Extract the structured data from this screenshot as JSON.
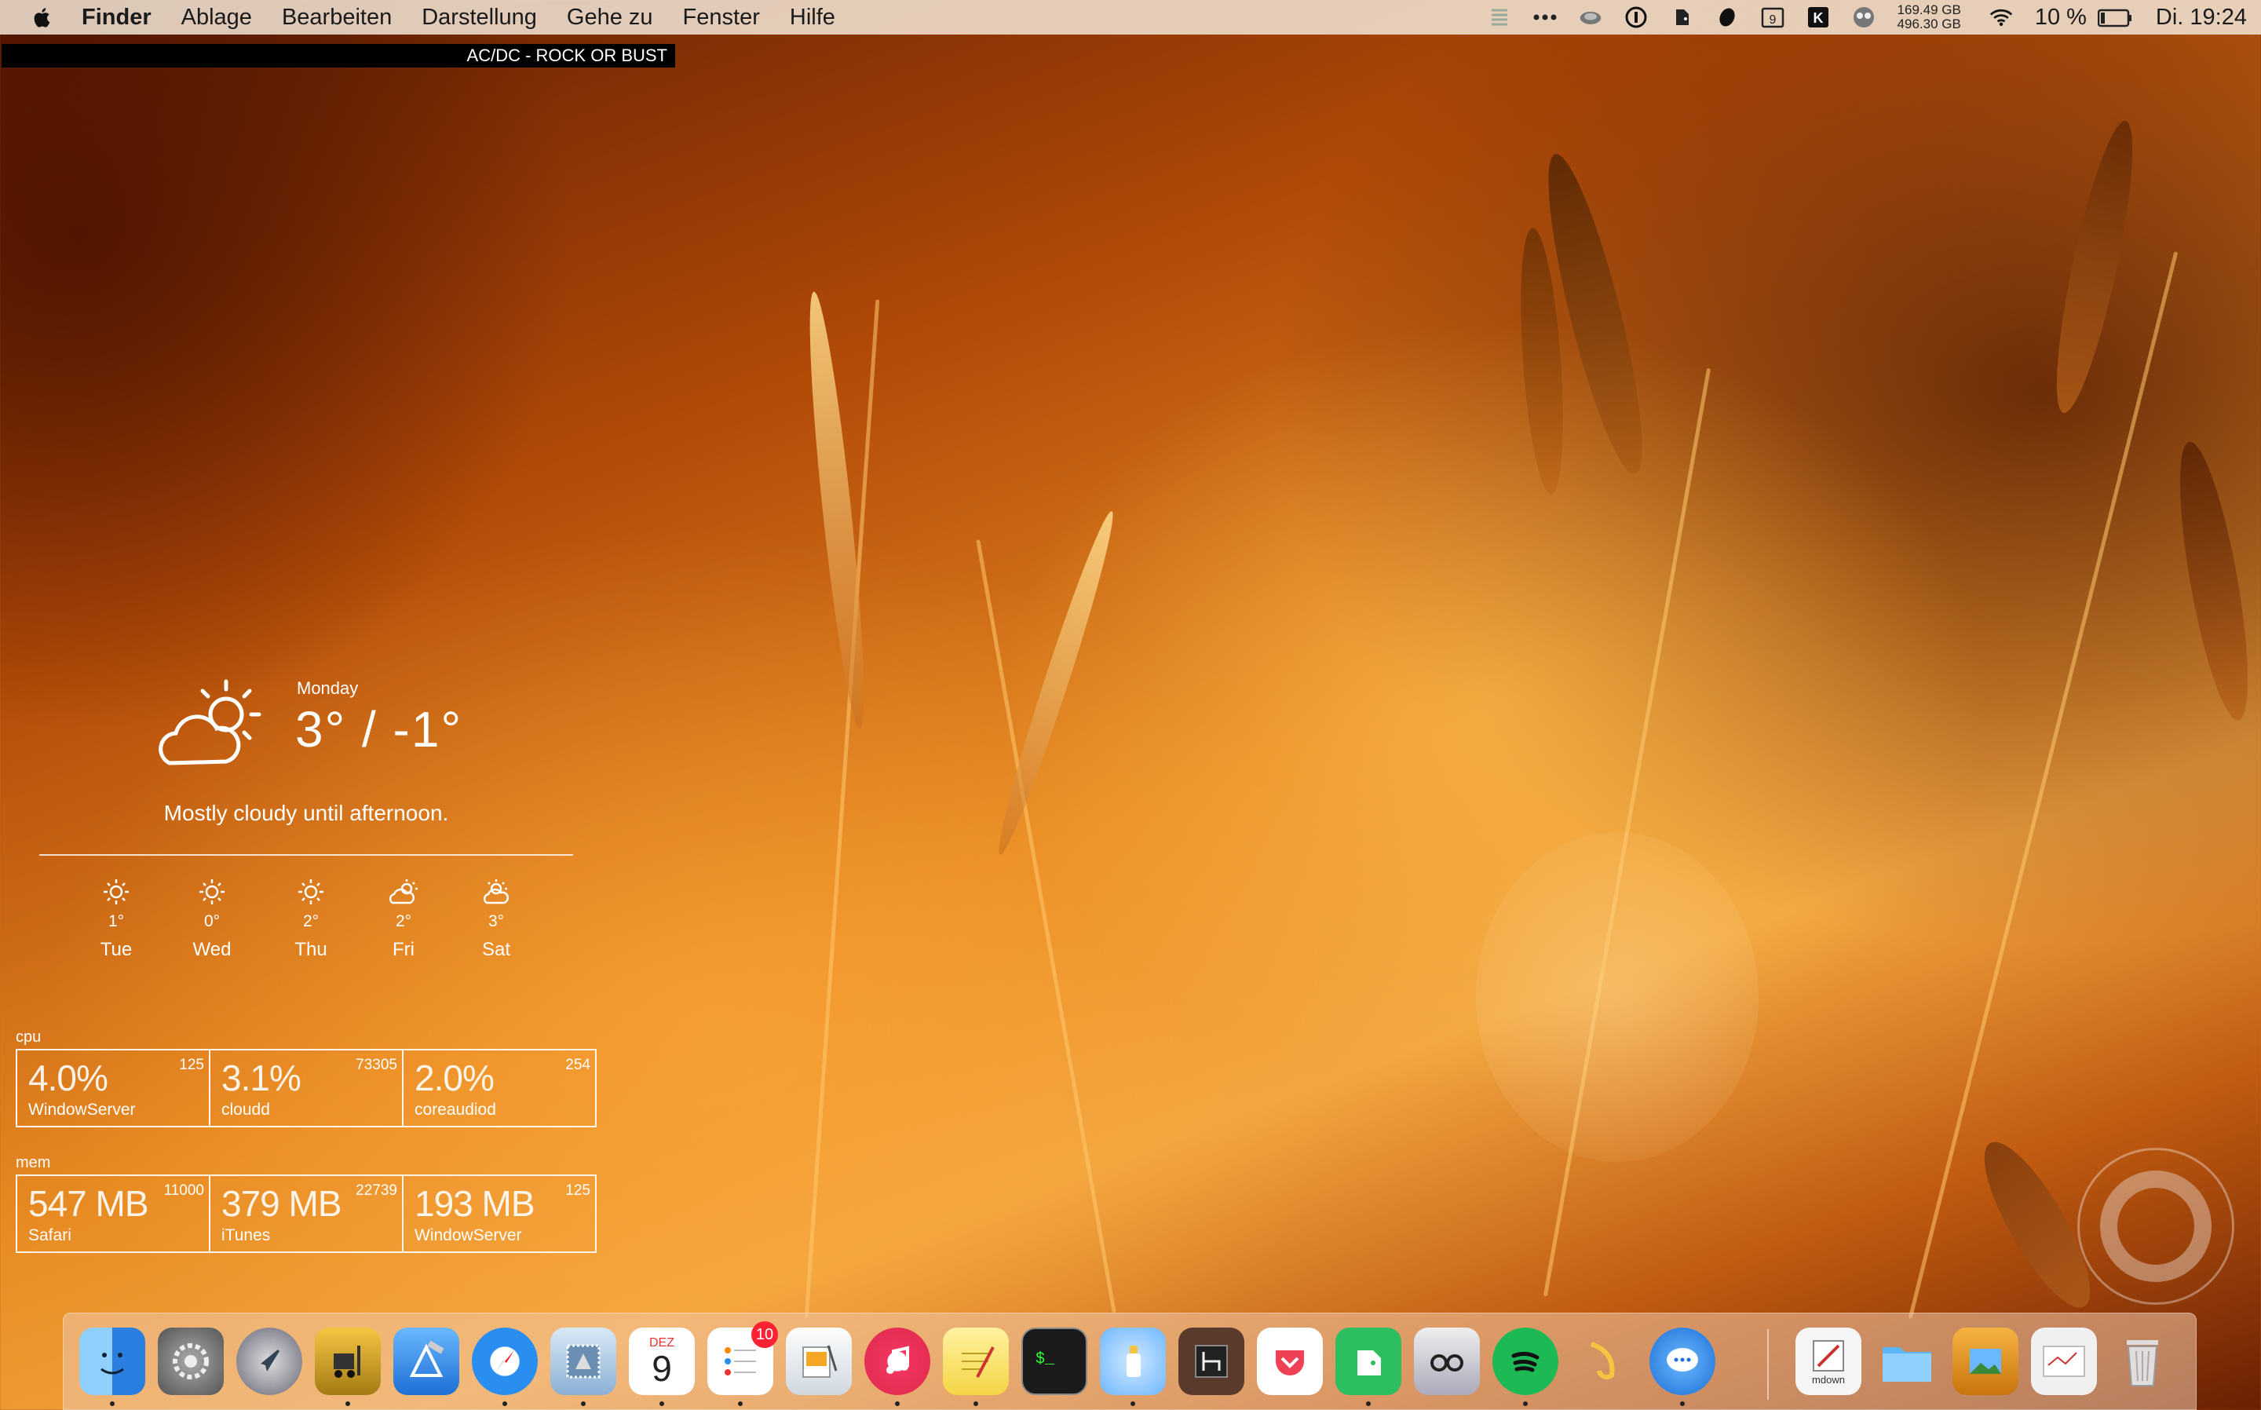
{
  "menubar": {
    "items": [
      "Finder",
      "Ablage",
      "Bearbeiten",
      "Darstellung",
      "Gehe zu",
      "Fenster",
      "Hilfe"
    ],
    "calendar_day": "9",
    "disk_free": "169.49 GB",
    "disk_total": "496.30 GB",
    "battery": "10 %",
    "clock": "Di. 19:24"
  },
  "now_playing": "AC/DC - ROCK OR BUST",
  "weather": {
    "day": "Monday",
    "temp": "3° / -1°",
    "summary": "Mostly cloudy until afternoon.",
    "forecast": [
      {
        "day": "Tue",
        "temp": "1°",
        "icon": "sun-icon"
      },
      {
        "day": "Wed",
        "temp": "0°",
        "icon": "sun-icon"
      },
      {
        "day": "Thu",
        "temp": "2°",
        "icon": "sun-icon"
      },
      {
        "day": "Fri",
        "temp": "2°",
        "icon": "partly-cloudy-icon"
      },
      {
        "day": "Sat",
        "temp": "3°",
        "icon": "partly-cloudy-icon"
      }
    ]
  },
  "cpu": {
    "label": "cpu",
    "processes": [
      {
        "value": "4.0%",
        "pid": "125",
        "name": "WindowServer"
      },
      {
        "value": "3.1%",
        "pid": "73305",
        "name": "cloudd"
      },
      {
        "value": "2.0%",
        "pid": "254",
        "name": "coreaudiod"
      }
    ]
  },
  "mem": {
    "label": "mem",
    "processes": [
      {
        "value": "547 MB",
        "pid": "11000",
        "name": "Safari"
      },
      {
        "value": "379 MB",
        "pid": "22739",
        "name": "iTunes"
      },
      {
        "value": "193 MB",
        "pid": "125",
        "name": "WindowServer"
      }
    ]
  },
  "dock": {
    "calendar_month": "DEZ",
    "calendar_day": "9",
    "reminders_badge": "10",
    "mdown_label": "mdown",
    "accent_colors": {
      "finder": "#3a9cf0",
      "safari": "#2a8ef0",
      "itunes": "#e8305a",
      "evernote": "#2dbe60",
      "spotify": "#1db954",
      "pocket": "#ef4056"
    }
  }
}
